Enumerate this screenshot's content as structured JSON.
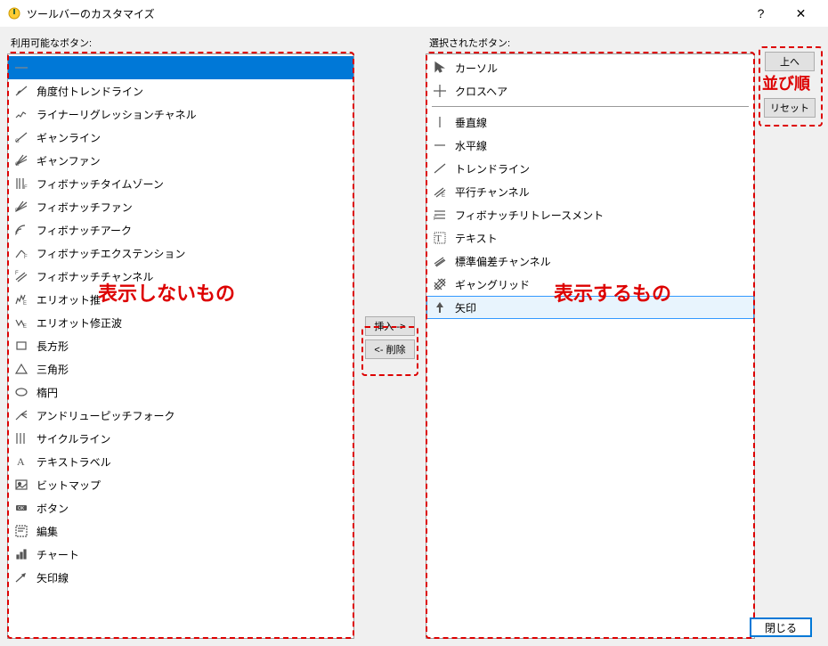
{
  "window": {
    "title": "ツールバーのカスタマイズ",
    "help_label": "?",
    "close_label": "✕"
  },
  "panels": {
    "available_label": "利用可能なボタン:",
    "selected_label": "選択されたボタン:"
  },
  "available_items": [
    {
      "icon": "separator",
      "label": ""
    },
    {
      "icon": "trendangle",
      "label": "角度付トレンドライン"
    },
    {
      "icon": "regression",
      "label": "ライナーリグレッションチャネル"
    },
    {
      "icon": "gannline",
      "label": "ギャンライン"
    },
    {
      "icon": "gannfan",
      "label": "ギャンファン"
    },
    {
      "icon": "fibotime",
      "label": "フィボナッチタイムゾーン"
    },
    {
      "icon": "fibofan",
      "label": "フィボナッチファン"
    },
    {
      "icon": "fiboarc",
      "label": "フィボナッチアーク"
    },
    {
      "icon": "fiboext",
      "label": "フィボナッチエクステンション"
    },
    {
      "icon": "fibochannel",
      "label": "フィボナッチチャンネル"
    },
    {
      "icon": "elliottimp",
      "label": "エリオット推"
    },
    {
      "icon": "elliottcor",
      "label": "エリオット修正波"
    },
    {
      "icon": "rectangle",
      "label": "長方形"
    },
    {
      "icon": "triangle",
      "label": "三角形"
    },
    {
      "icon": "ellipse",
      "label": "楕円"
    },
    {
      "icon": "pitchfork",
      "label": "アンドリューピッチフォーク"
    },
    {
      "icon": "cycle",
      "label": "サイクルライン"
    },
    {
      "icon": "textlabel",
      "label": "テキストラベル"
    },
    {
      "icon": "bitmap",
      "label": "ビットマップ"
    },
    {
      "icon": "button",
      "label": "ボタン"
    },
    {
      "icon": "edit",
      "label": "編集"
    },
    {
      "icon": "chart",
      "label": "チャート"
    },
    {
      "icon": "arrowline",
      "label": "矢印線"
    }
  ],
  "selected_items": [
    {
      "icon": "cursor",
      "label": "カーソル"
    },
    {
      "icon": "crosshair",
      "label": "クロスヘア"
    },
    {
      "type": "sep"
    },
    {
      "icon": "vline",
      "label": "垂直線"
    },
    {
      "icon": "hline",
      "label": "水平線"
    },
    {
      "icon": "trendline",
      "label": "トレンドライン"
    },
    {
      "icon": "equichannel",
      "label": "平行チャンネル"
    },
    {
      "icon": "fiboretrace",
      "label": "フィボナッチリトレースメント"
    },
    {
      "icon": "text",
      "label": "テキスト"
    },
    {
      "icon": "stddevch",
      "label": "標準偏差チャンネル"
    },
    {
      "icon": "ganngrid",
      "label": "ギャングリッド"
    },
    {
      "icon": "arrows",
      "label": "矢印",
      "outlined": true
    }
  ],
  "buttons": {
    "insert": "挿入 ->",
    "remove": "<- 削除",
    "up": "上へ",
    "reset": "リセット",
    "close": "閉じる"
  },
  "annotations": {
    "hide": "表示しないもの",
    "show": "表示するもの",
    "order": "並び順"
  }
}
